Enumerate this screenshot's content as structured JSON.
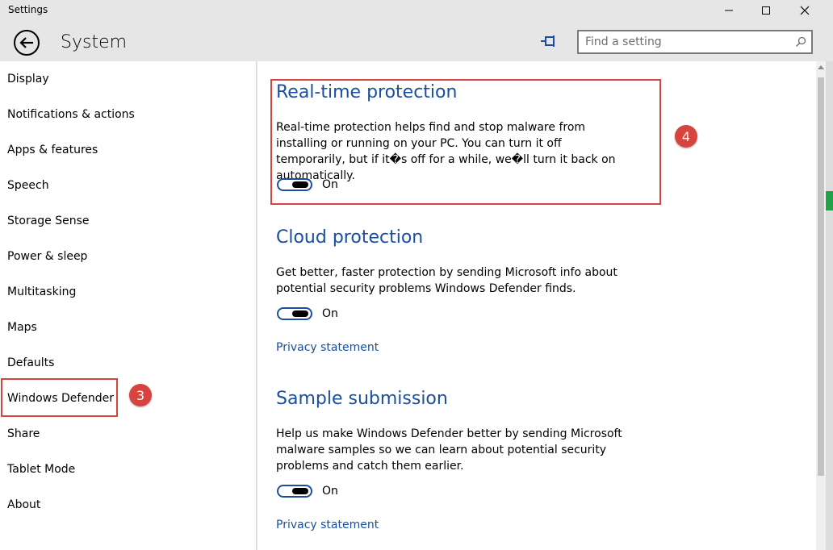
{
  "window": {
    "title": "Settings"
  },
  "header": {
    "page_title": "System",
    "search_placeholder": "Find a setting"
  },
  "sidebar": {
    "items": [
      {
        "label": "Display"
      },
      {
        "label": "Notifications & actions"
      },
      {
        "label": "Apps & features"
      },
      {
        "label": "Speech"
      },
      {
        "label": "Storage Sense"
      },
      {
        "label": "Power & sleep"
      },
      {
        "label": "Multitasking"
      },
      {
        "label": "Maps"
      },
      {
        "label": "Defaults"
      },
      {
        "label": "Windows Defender"
      },
      {
        "label": "Share"
      },
      {
        "label": "Tablet Mode"
      },
      {
        "label": "About"
      }
    ],
    "selected_item": "Windows Defender"
  },
  "annotations": {
    "step_sidebar": "3",
    "step_main": "4",
    "color": "#d9433e"
  },
  "main": {
    "sections": [
      {
        "title": "Real-time protection",
        "description": "Real-time protection helps find and stop malware from installing or running on your PC. You can turn it off temporarily, but if it�s off for a while, we�ll turn it back on automatically.",
        "toggle_state": "On"
      },
      {
        "title": "Cloud protection",
        "description": "Get better, faster protection by sending Microsoft info about potential security problems Windows Defender finds.",
        "toggle_state": "On",
        "link": "Privacy statement"
      },
      {
        "title": "Sample submission",
        "description": "Help us make Windows Defender better by sending Microsoft malware samples so we can learn about potential security problems and catch them earlier.",
        "toggle_state": "On",
        "link": "Privacy statement"
      }
    ]
  },
  "colors": {
    "accent": "#1a4ea1",
    "chrome": "#e6e6e6",
    "annotation": "#d9433e"
  }
}
